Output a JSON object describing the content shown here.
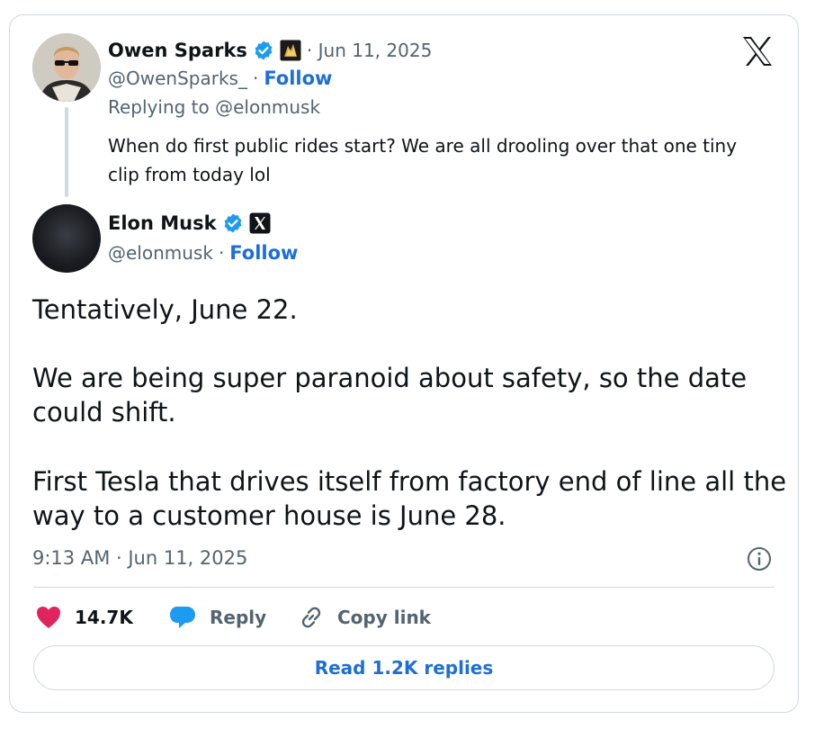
{
  "reply_tweet": {
    "name": "Owen Sparks",
    "handle": "@OwenSparks_",
    "separator": "·",
    "date": "· Jun 11, 2025",
    "follow_label": "Follow",
    "replying_to": "Replying to @elonmusk",
    "text_line1": "When do first public rides start? We are all drooling over that one tiny",
    "text_line2": "clip from today lol"
  },
  "main_tweet": {
    "name": "Elon Musk",
    "handle": "@elonmusk",
    "separator": "·",
    "follow_label": "Follow",
    "text_line1": "Tentatively, June 22.",
    "text_line2": "We are being super paranoid about safety, so the date",
    "text_line3": "could shift.",
    "text_line4": "First Tesla that drives itself from factory end of line all the",
    "text_line5": "way to a customer house is June 28.",
    "timestamp": "9:13 AM · Jun 11, 2025"
  },
  "actions": {
    "likes": "14.7K",
    "reply_label": "Reply",
    "copy_label": "Copy link"
  },
  "read_replies_label": "Read 1.2K replies",
  "colors": {
    "accent": "#1d6fd6",
    "verified": "#1d9bf0",
    "like": "#e0245e",
    "border": "#cfd9de",
    "muted": "#536471"
  },
  "icons": [
    "verified-badge-icon",
    "affiliate-badge-icon",
    "x-logo-icon",
    "heart-icon",
    "reply-bubble-icon",
    "link-icon",
    "info-icon"
  ]
}
